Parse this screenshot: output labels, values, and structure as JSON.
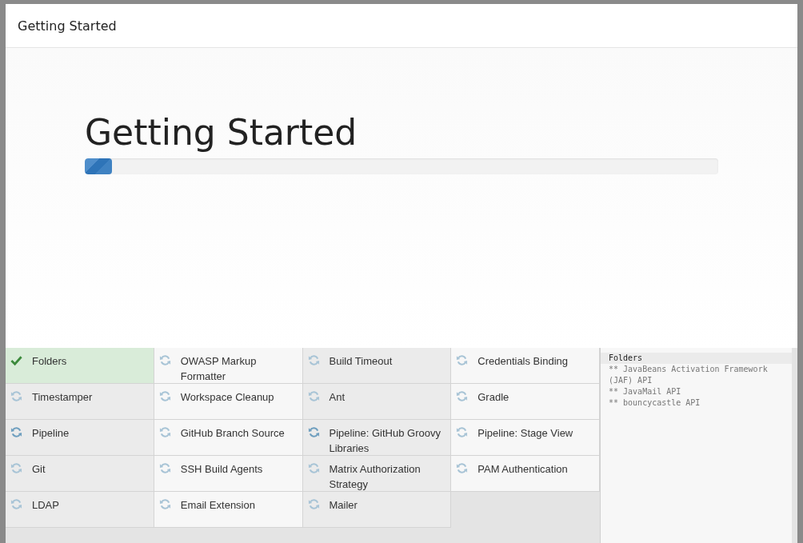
{
  "window": {
    "title": "Getting Started"
  },
  "heading": "Getting Started",
  "progress": {
    "level": 0.043
  },
  "plugins": [
    {
      "name": "Folders",
      "kind": "done"
    },
    {
      "name": "OWASP Markup Formatter",
      "kind": "pending"
    },
    {
      "name": "Build Timeout",
      "kind": "pending"
    },
    {
      "name": "Credentials Binding",
      "kind": "pending"
    },
    {
      "name": "Timestamper",
      "kind": "pending"
    },
    {
      "name": "Workspace Cleanup",
      "kind": "pending"
    },
    {
      "name": "Ant",
      "kind": "pending"
    },
    {
      "name": "Gradle",
      "kind": "pending"
    },
    {
      "name": "Pipeline",
      "kind": "installing"
    },
    {
      "name": "GitHub Branch Source",
      "kind": "pending"
    },
    {
      "name": "Pipeline: GitHub Groovy Libraries",
      "kind": "installing"
    },
    {
      "name": "Pipeline: Stage View",
      "kind": "pending"
    },
    {
      "name": "Git",
      "kind": "pending"
    },
    {
      "name": "SSH Build Agents",
      "kind": "pending"
    },
    {
      "name": "Matrix Authorization Strategy",
      "kind": "pending"
    },
    {
      "name": "PAM Authentication",
      "kind": "pending"
    },
    {
      "name": "LDAP",
      "kind": "pending"
    },
    {
      "name": "Email Extension",
      "kind": "pending"
    },
    {
      "name": "Mailer",
      "kind": "pending"
    }
  ],
  "log": {
    "title": "Folders",
    "lines": [
      "** JavaBeans Activation Framework (JAF) API",
      "** JavaMail API",
      "** bouncycastle API"
    ]
  }
}
